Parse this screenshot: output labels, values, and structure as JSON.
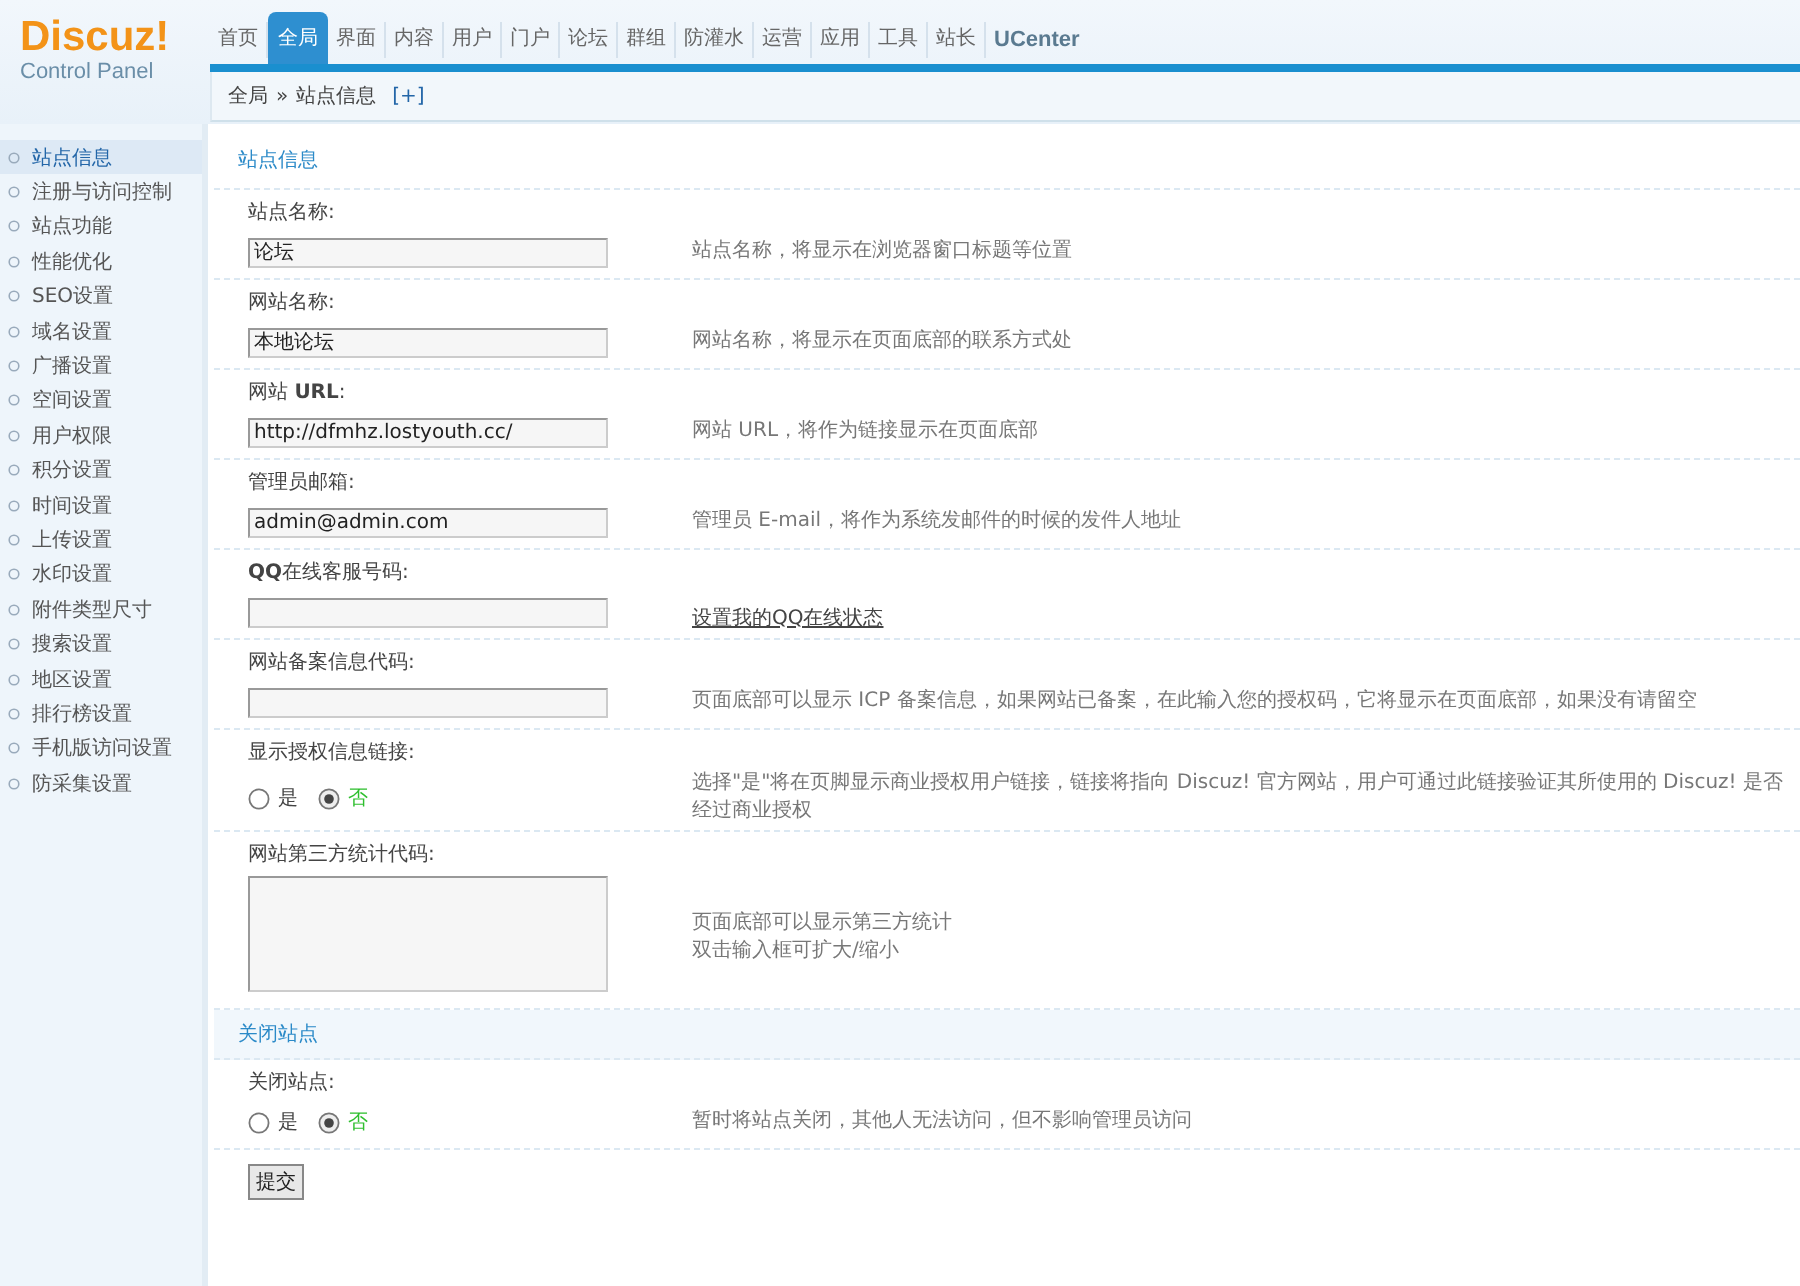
{
  "logo": {
    "name": "Discuz!",
    "subtitle": "Control Panel"
  },
  "nav": [
    {
      "label": "首页",
      "selected": false
    },
    {
      "label": "全局",
      "selected": true
    },
    {
      "label": "界面",
      "selected": false
    },
    {
      "label": "内容",
      "selected": false
    },
    {
      "label": "用户",
      "selected": false
    },
    {
      "label": "门户",
      "selected": false
    },
    {
      "label": "论坛",
      "selected": false
    },
    {
      "label": "群组",
      "selected": false
    },
    {
      "label": "防灌水",
      "selected": false
    },
    {
      "label": "运营",
      "selected": false
    },
    {
      "label": "应用",
      "selected": false
    },
    {
      "label": "工具",
      "selected": false
    },
    {
      "label": "站长",
      "selected": false
    },
    {
      "label": "UCenter",
      "selected": false
    }
  ],
  "breadcrumb": {
    "items": [
      "全局",
      "站点信息"
    ],
    "separator": "»",
    "add": "[+]"
  },
  "sidebar": {
    "items": [
      {
        "label": "站点信息",
        "selected": true
      },
      {
        "label": "注册与访问控制",
        "selected": false
      },
      {
        "label": "站点功能",
        "selected": false
      },
      {
        "label": "性能优化",
        "selected": false
      },
      {
        "label": "SEO设置",
        "selected": false
      },
      {
        "label": "域名设置",
        "selected": false
      },
      {
        "label": "广播设置",
        "selected": false
      },
      {
        "label": "空间设置",
        "selected": false
      },
      {
        "label": "用户权限",
        "selected": false
      },
      {
        "label": "积分设置",
        "selected": false
      },
      {
        "label": "时间设置",
        "selected": false
      },
      {
        "label": "上传设置",
        "selected": false
      },
      {
        "label": "水印设置",
        "selected": false
      },
      {
        "label": "附件类型尺寸",
        "selected": false
      },
      {
        "label": "搜索设置",
        "selected": false
      },
      {
        "label": "地区设置",
        "selected": false
      },
      {
        "label": "排行榜设置",
        "selected": false
      },
      {
        "label": "手机版访问设置",
        "selected": false
      },
      {
        "label": "防采集设置",
        "selected": false
      }
    ]
  },
  "sections": [
    {
      "title": "站点信息",
      "settings": [
        {
          "kind": "text",
          "label": "站点名称:",
          "value": "论坛",
          "hint": "站点名称，将显示在浏览器窗口标题等位置"
        },
        {
          "kind": "text",
          "label": "网站名称:",
          "value": "本地论坛",
          "hint": "网站名称，将显示在页面底部的联系方式处"
        },
        {
          "kind": "text",
          "label": "网站 **URL**:",
          "value": "http://dfmhz.lostyouth.cc/",
          "hint": "网站 URL，将作为链接显示在页面底部"
        },
        {
          "kind": "text",
          "label": "管理员邮箱:",
          "value": "admin@admin.com",
          "hint": "管理员 E-mail，将作为系统发邮件的时候的发件人地址"
        },
        {
          "kind": "link",
          "label": "**QQ**在线客服号码:",
          "link": "设置我的QQ在线状态"
        },
        {
          "kind": "text",
          "label": "网站备案信息代码:",
          "hint": "页面底部可以显示 ICP 备案信息，如果网站已备案，在此输入您的授权码，它将显示在页面底部，如果没有请留空"
        },
        {
          "kind": "radio",
          "label": "显示授权信息链接:",
          "options": [
            {
              "label": "是",
              "selected": false
            },
            {
              "label": "否",
              "selected": true
            }
          ],
          "hint": "选择\"是\"将在页脚显示商业授权用户链接，链接将指向 Discuz! 官方网站，用户可通过此链接验证其所使用的 Discuz! 是否经过商业授权"
        },
        {
          "kind": "textarea",
          "label": "网站第三方统计代码:",
          "hints": [
            "页面底部可以显示第三方统计",
            "双击输入框可扩大/缩小"
          ]
        }
      ]
    },
    {
      "title": "关闭站点",
      "settings": [
        {
          "kind": "radio",
          "label": "关闭站点:",
          "options": [
            {
              "label": "是",
              "selected": false
            },
            {
              "label": "否",
              "selected": true
            }
          ],
          "hint": "暂时将站点关闭，其他人无法访问，但不影响管理员访问"
        }
      ]
    }
  ],
  "submit": "提交"
}
